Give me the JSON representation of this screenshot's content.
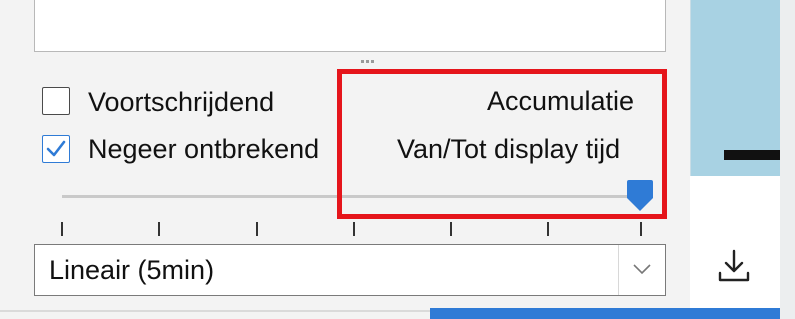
{
  "options": {
    "moving_label": "Voortschrijdend",
    "moving_checked": false,
    "ignore_missing_label": "Negeer ontbrekend",
    "ignore_missing_checked": true
  },
  "mode": {
    "accumulation_label": "Accumulatie",
    "from_to_label": "Van/Tot display tijd"
  },
  "slider": {
    "value_fraction": 1.0,
    "tick_count": 7
  },
  "interpolation": {
    "selected": "Lineair (5min)"
  },
  "icons": {
    "dropdown": "chevron-down-icon",
    "download": "download-icon",
    "checkmark": "checkmark-icon"
  },
  "colors": {
    "accent": "#2f7bd6",
    "highlight": "#e5151b",
    "side_panel": "#a8d2e3"
  }
}
